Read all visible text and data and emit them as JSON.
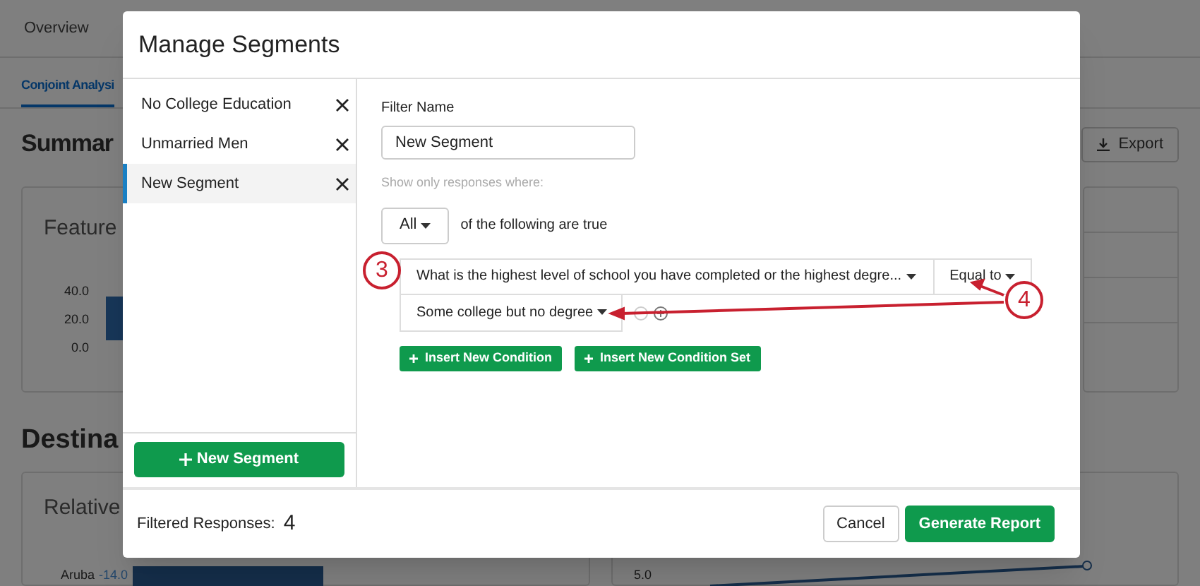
{
  "background": {
    "tabs": [
      {
        "label": "Overview",
        "selected": false
      }
    ],
    "subtabs": [
      {
        "label": "Conjoint Analysi",
        "selected": true
      }
    ],
    "summary_title": "Summar",
    "export_button": "Export",
    "feature_card": {
      "title": "Feature",
      "y_ticks": [
        "40.0",
        "20.0",
        "0.0"
      ]
    },
    "section_title": "Destina",
    "relative_card": {
      "title": "Relative",
      "row_label": "Aruba",
      "row_value": "-14.0"
    },
    "line_card": {
      "y_tick": "5.0"
    }
  },
  "modal": {
    "title": "Manage Segments",
    "segments": [
      {
        "label": "No College Education",
        "selected": false
      },
      {
        "label": "Unmarried Men",
        "selected": false
      },
      {
        "label": "New Segment",
        "selected": true
      }
    ],
    "new_segment_button": "New Segment",
    "filter_name_label": "Filter Name",
    "filter_name": "New Segment",
    "hint": "Show only responses where:",
    "match": "All",
    "match_suffix": "of the following are true",
    "condition": {
      "question": "What is the highest level of school you have completed or the highest degre...",
      "operator": "Equal to",
      "value": "Some college but no degree"
    },
    "insert_buttons": [
      "Insert New Condition",
      "Insert New Condition Set"
    ],
    "filtered_label": "Filtered Responses:",
    "filtered_count": "4",
    "footer_buttons": [
      {
        "label": "Cancel",
        "kind": "secondary"
      },
      {
        "label": "Generate Report",
        "kind": "primary"
      }
    ]
  },
  "annotations": [
    {
      "label": "3"
    },
    {
      "label": "4"
    }
  ]
}
